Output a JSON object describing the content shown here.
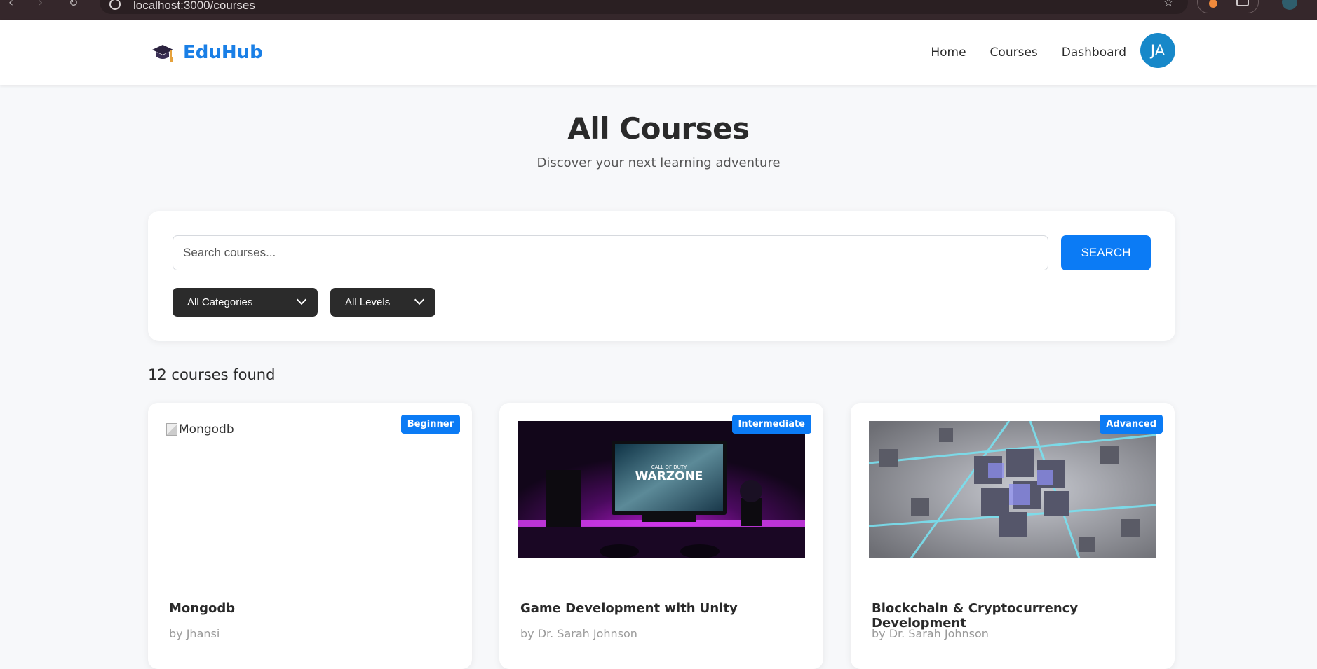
{
  "browser": {
    "url": "localhost:3000/courses"
  },
  "header": {
    "brand": "EduHub",
    "brand_icon": "graduation-cap-icon",
    "nav": [
      "Home",
      "Courses",
      "Dashboard"
    ],
    "avatar_initials": "JA"
  },
  "hero": {
    "title": "All Courses",
    "subtitle": "Discover your next learning adventure"
  },
  "search": {
    "placeholder": "Search courses...",
    "button_label": "SEARCH",
    "category_filter": "All Categories",
    "level_filter": "All Levels"
  },
  "results": {
    "count_label": "12 courses found"
  },
  "courses": [
    {
      "title": "Mongodb",
      "author": "by Jhansi",
      "level": "Beginner",
      "image_alt": "Mongodb",
      "image_broken": true
    },
    {
      "title": "Game Development with Unity",
      "author": "by Dr. Sarah Johnson",
      "level": "Intermediate",
      "image_text_top": "CALL OF DUTY",
      "image_text_main": "WARZONE"
    },
    {
      "title": "Blockchain & Cryptocurrency Development",
      "author": "by Dr. Sarah Johnson",
      "level": "Advanced"
    }
  ],
  "colors": {
    "accent": "#0b7bf5",
    "brand": "#1a7fe6",
    "filter_bg": "#2b2b2b",
    "avatar_bg": "#1788c9"
  }
}
